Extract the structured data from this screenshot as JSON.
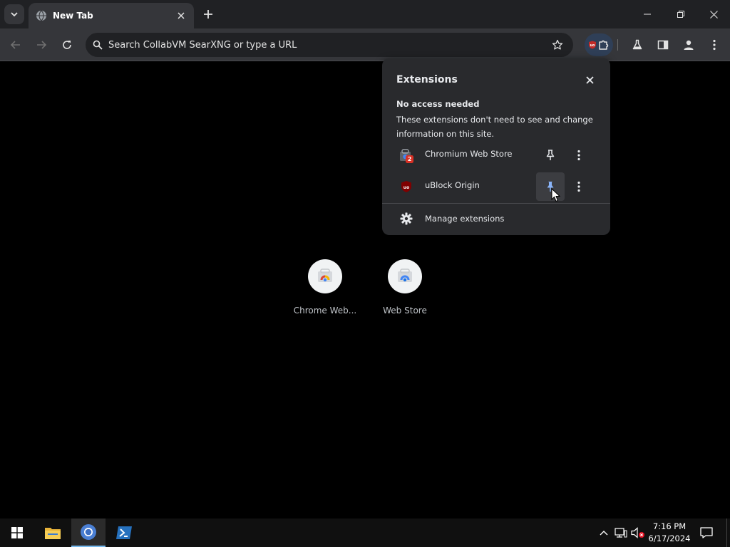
{
  "colors": {
    "background": "#000000",
    "tabbar": "#202124",
    "toolbar": "#35363a",
    "popup": "#292a2d",
    "accent": "#8ab4f8",
    "taskbar": "#101010"
  },
  "tab": {
    "title": "New Tab",
    "favicon": "globe-icon"
  },
  "toolbar": {
    "omnibox_placeholder": "Search CollabVM SearXNG or type a URL"
  },
  "extensions_popup": {
    "title": "Extensions",
    "section_heading": "No access needed",
    "section_description": "These extensions don't need to see and change information on this site.",
    "items": [
      {
        "name": "Chromium Web Store",
        "badge": "2",
        "pinned": false,
        "icon": "web-store-icon"
      },
      {
        "name": "uBlock Origin",
        "pinned": true,
        "icon": "ublock-icon"
      }
    ],
    "manage_label": "Manage extensions"
  },
  "shortcuts": [
    {
      "label": "Chrome Web...",
      "icon": "chrome-web-store-icon"
    },
    {
      "label": "Web Store",
      "icon": "web-store-icon"
    }
  ],
  "taskbar": {
    "items": [
      "start-icon",
      "file-explorer-icon",
      "chromium-icon",
      "powershell-icon"
    ],
    "active_item": "chromium-icon",
    "time": "7:16 PM",
    "date": "6/17/2024"
  }
}
